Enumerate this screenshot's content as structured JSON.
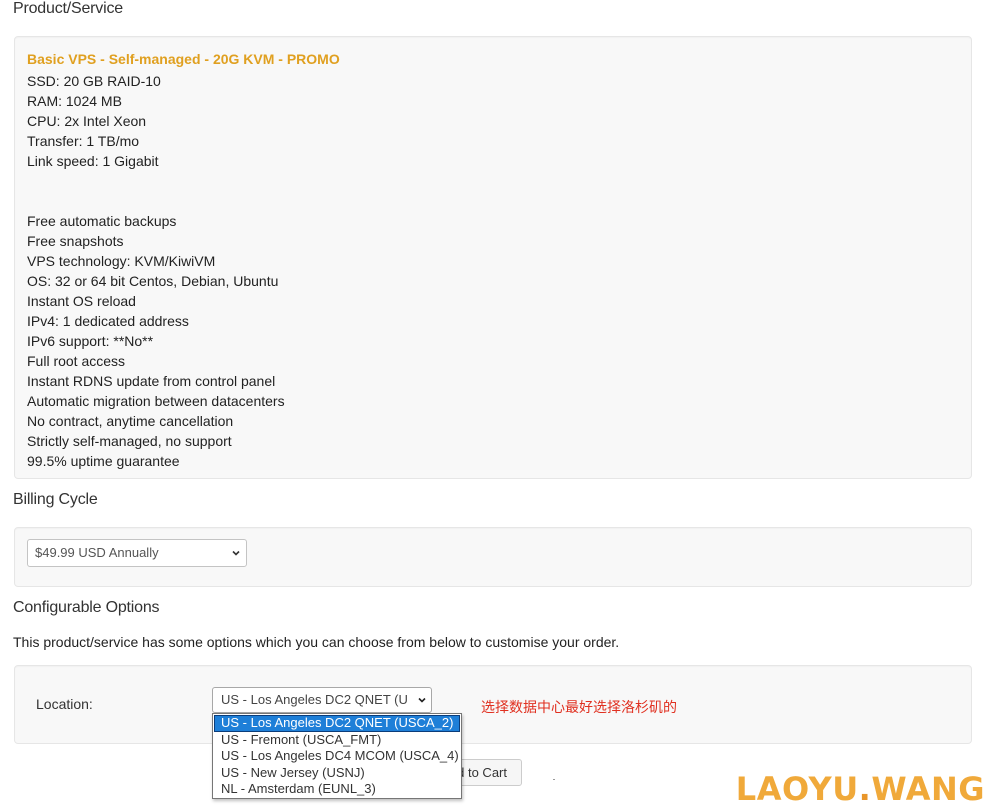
{
  "product_section": {
    "heading": "Product/Service",
    "name": "Basic VPS - Self-managed - 20G KVM - PROMO",
    "description_lines": [
      "SSD: 20 GB RAID-10",
      "RAM: 1024 MB",
      "CPU: 2x Intel Xeon",
      "Transfer: 1 TB/mo",
      "Link speed: 1 Gigabit",
      "",
      "",
      "Free automatic backups",
      "Free snapshots",
      "VPS technology: KVM/KiwiVM",
      "OS: 32 or 64 bit Centos, Debian, Ubuntu",
      "Instant OS reload",
      "IPv4: 1 dedicated address",
      "IPv6 support: **No**",
      "Full root access",
      "Instant RDNS update from control panel",
      "Automatic migration between datacenters",
      "No contract, anytime cancellation",
      "Strictly self-managed, no support",
      "99.5% uptime guarantee"
    ]
  },
  "billing": {
    "heading": "Billing Cycle",
    "selected": "$49.99 USD Annually"
  },
  "configurable": {
    "heading": "Configurable Options",
    "intro": "This product/service has some options which you can choose from below to customise your order.",
    "location_label": "Location:",
    "location_selected_display": "US - Los Angeles DC2 QNET (U",
    "location_options": [
      "US - Los Angeles DC2 QNET (USCA_2)",
      "US - Fremont (USCA_FMT)",
      "US - Los Angeles DC4 MCOM (USCA_4)",
      "US - New Jersey (USNJ)",
      "NL - Amsterdam (EUNL_3)"
    ],
    "selected_index": 0,
    "annotation": "选择数据中心最好选择洛杉矶的"
  },
  "cart_button_label": "Add to Cart",
  "watermark": {
    "part1": "LAOYU",
    "dot": ".",
    "part2": "WANG"
  },
  "colors": {
    "product_name": "#e0a020",
    "annotation": "#e03020",
    "selected_option": "#1e7fd8",
    "watermark": "#f0a93a"
  },
  "icons": {
    "select_arrow": "chevron-down-icon"
  }
}
